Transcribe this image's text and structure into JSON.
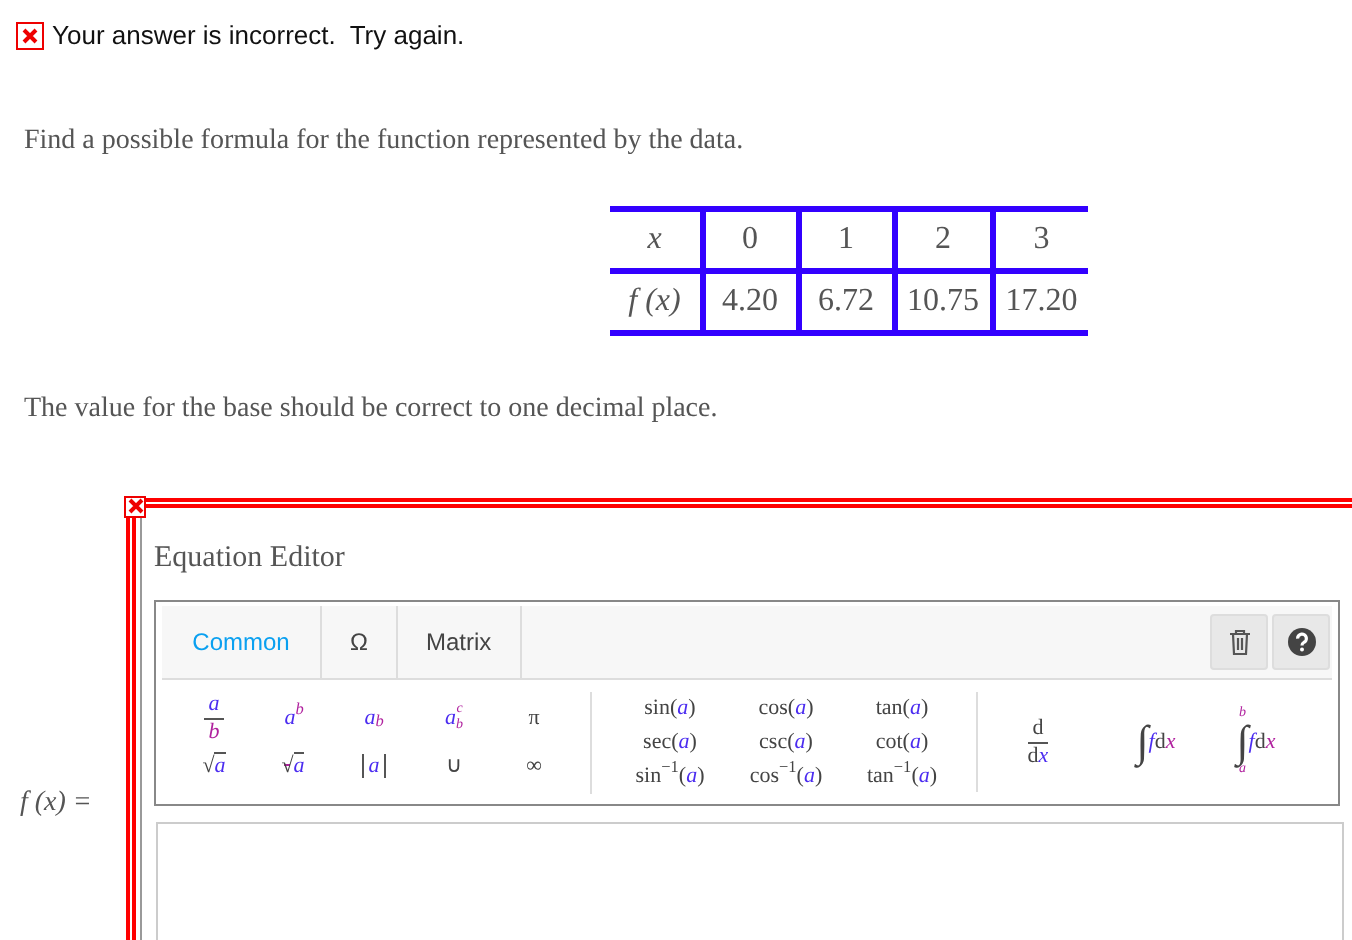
{
  "feedback": {
    "correct": false,
    "text": "Your answer is incorrect.  Try again."
  },
  "question": "Find a possible formula for the function represented by the data.",
  "table": {
    "rows": [
      {
        "header": "x",
        "cells": [
          "0",
          "1",
          "2",
          "3"
        ]
      },
      {
        "header": "f (x)",
        "cells": [
          "4.20",
          "6.72",
          "10.75",
          "17.20"
        ]
      }
    ]
  },
  "note": "The value for the base should be correct to one decimal place.",
  "answer": {
    "correct": false,
    "label": "f (x) =",
    "editor": {
      "title": "Equation Editor",
      "tabs": [
        {
          "label": "Common",
          "selected": true
        },
        {
          "label": "Ω",
          "selected": false
        },
        {
          "label": "Matrix",
          "selected": false
        }
      ],
      "groups": [
        {
          "items": [
            {
              "kind": "frac",
              "parts": [
                "a",
                "b"
              ]
            },
            {
              "kind": "sup",
              "parts": [
                "a",
                "b"
              ]
            },
            {
              "kind": "sub",
              "parts": [
                "a",
                "b"
              ]
            },
            {
              "kind": "subsup",
              "parts": [
                "a",
                "b",
                "c"
              ]
            },
            {
              "kind": "symbol",
              "parts": [
                "π"
              ]
            },
            {
              "kind": "sqrt",
              "parts": [
                "√",
                "a"
              ]
            },
            {
              "kind": "root",
              "parts": [
                "√",
                "a"
              ]
            },
            {
              "kind": "abs",
              "parts": [
                "a"
              ]
            },
            {
              "kind": "symbol",
              "parts": [
                "∪"
              ]
            },
            {
              "kind": "symbol",
              "parts": [
                "∞"
              ]
            }
          ]
        },
        {
          "items": [
            {
              "kind": "func",
              "parts": [
                "sin(",
                "a",
                ")"
              ]
            },
            {
              "kind": "func",
              "parts": [
                "cos(",
                "a",
                ")"
              ]
            },
            {
              "kind": "func",
              "parts": [
                "tan(",
                "a",
                ")"
              ]
            },
            {
              "kind": "func",
              "parts": [
                "sec(",
                "a",
                ")"
              ]
            },
            {
              "kind": "func",
              "parts": [
                "csc(",
                "a",
                ")"
              ]
            },
            {
              "kind": "func",
              "parts": [
                "cot(",
                "a",
                ")"
              ]
            },
            {
              "kind": "inverse",
              "parts": [
                "sin",
                "−1",
                "(",
                "a",
                ")"
              ]
            },
            {
              "kind": "inverse",
              "parts": [
                "cos",
                "−1",
                "(",
                "a",
                ")"
              ]
            },
            {
              "kind": "inverse",
              "parts": [
                "tan",
                "−1",
                "(",
                "a",
                ")"
              ]
            }
          ]
        },
        {
          "items": [
            {
              "kind": "deriv",
              "parts": [
                "d",
                "d",
                "x"
              ]
            },
            {
              "kind": "integral",
              "parts": [
                "∫",
                "f",
                "d",
                "x"
              ]
            },
            {
              "kind": "defint",
              "parts": [
                "b",
                "∫",
                "a",
                "f",
                "d",
                "x"
              ]
            }
          ]
        }
      ]
    }
  }
}
